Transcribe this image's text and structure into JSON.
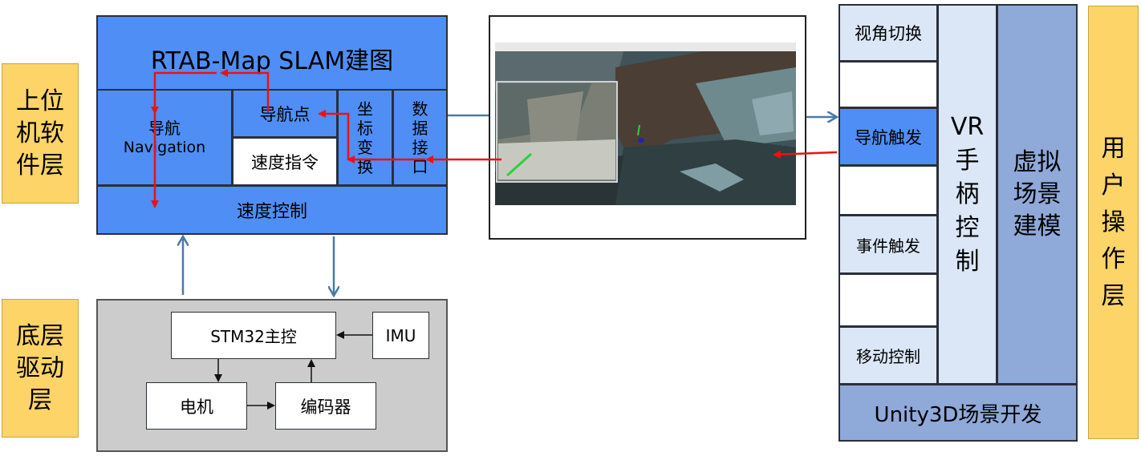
{
  "left_layers": {
    "upper": "上位\n机软\n件层",
    "lower": "底层\n驱动\n层"
  },
  "software": {
    "title": "RTAB-Map SLAM建图",
    "nav_cn": "导航",
    "nav_en": "Navigation",
    "nav_point": "导航点",
    "speed_cmd": "速度指令",
    "coord": "坐\n标\n变\n换",
    "data_iface": "数\n据\n接\n口",
    "speed_ctrl": "速度控制"
  },
  "hardware": {
    "stm32": "STM32主控",
    "imu": "IMU",
    "motor": "电机",
    "encoder": "编码器"
  },
  "vr": {
    "view_switch": "视角切换",
    "nav_trigger": "导航触发",
    "event_trigger": "事件触发",
    "move_ctrl": "移动控制",
    "handle": "VR\n手\n柄\n控\n制",
    "scene_model": "虚拟\n场景\n建模",
    "unity": "Unity3D场景开发",
    "user_layer": "用\n户\n操\n作\n层"
  },
  "colors": {
    "layer_yellow": "#fcd468",
    "blue": "#4f8ef5",
    "red_arrow": "#ee1111",
    "steel_arrow": "#4a7aa6"
  }
}
